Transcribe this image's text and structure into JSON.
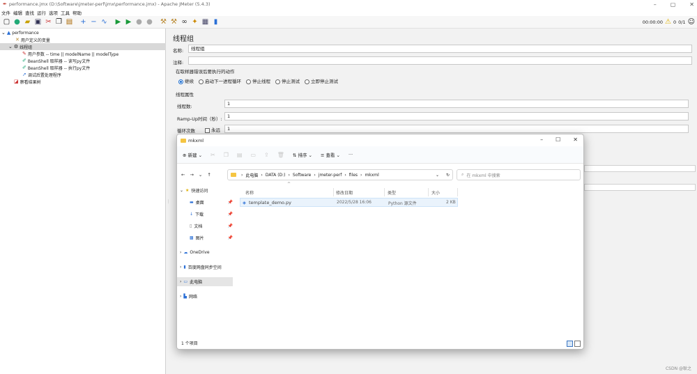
{
  "window": {
    "title": "performance.jmx (D:\\Software\\jmeter-perf\\jmx\\performance.jmx) - Apache JMeter (5.4.3)",
    "controls": [
      "–",
      "▢",
      "✕"
    ]
  },
  "menu": [
    "文件",
    "编辑",
    "查找",
    "运行",
    "选项",
    "工具",
    "帮助"
  ],
  "toolbar_right": {
    "timer": "00:00:00",
    "warnings": "0",
    "threads": "0/1"
  },
  "tree": {
    "root": "performance",
    "items": [
      "用户定义的变量",
      "线程组",
      "用户参数 -- time || modelName || modelType",
      "BeanShell 取样器 -- 读写py文件",
      "BeanShell 取样器 -- 执行py文件",
      "调试后置处理程序",
      "察看结果树"
    ]
  },
  "panel": {
    "title": "线程组",
    "name_label": "名称:",
    "name_value": "线程组",
    "comment_label": "注释:",
    "comment_value": "",
    "error_section": "在取样器错误后要执行的动作",
    "actions": [
      "继续",
      "启动下一进程循环",
      "停止线程",
      "停止测试",
      "立即停止测试"
    ],
    "props_section": "线程属性",
    "threads_label": "线程数:",
    "threads_value": "1",
    "rampup_label": "Ramp-Up时间（秒）:",
    "rampup_value": "1",
    "loop_label": "循环次数",
    "loop_forever": "永远",
    "loop_value": "1"
  },
  "explorer": {
    "title": "mkxml",
    "controls": [
      "–",
      "☐",
      "✕"
    ],
    "commands": {
      "new": "新建",
      "sort": "排序",
      "view": "查看",
      "more": "···"
    },
    "breadcrumb": [
      "此电脑",
      "DATA (D:)",
      "Software",
      "jmeter-perf",
      "files",
      "mkxml"
    ],
    "search_placeholder": "在 mkxml 中搜索",
    "nav": {
      "quick": "快速访问",
      "desktop": "桌面",
      "downloads": "下载",
      "documents": "文档",
      "pictures": "图片",
      "onedrive": "OneDrive",
      "baidu": "百度网盘同步空间",
      "thispc": "此电脑",
      "network": "网络"
    },
    "columns": {
      "name": "名称",
      "modified": "修改日期",
      "type": "类型",
      "size": "大小"
    },
    "files": [
      {
        "name": "template_demo.py",
        "modified": "2022/5/28 16:06",
        "type": "Python 源文件",
        "size": "2 KB"
      }
    ],
    "status": "1 个项目"
  },
  "watermark": "CSDN @耿之"
}
